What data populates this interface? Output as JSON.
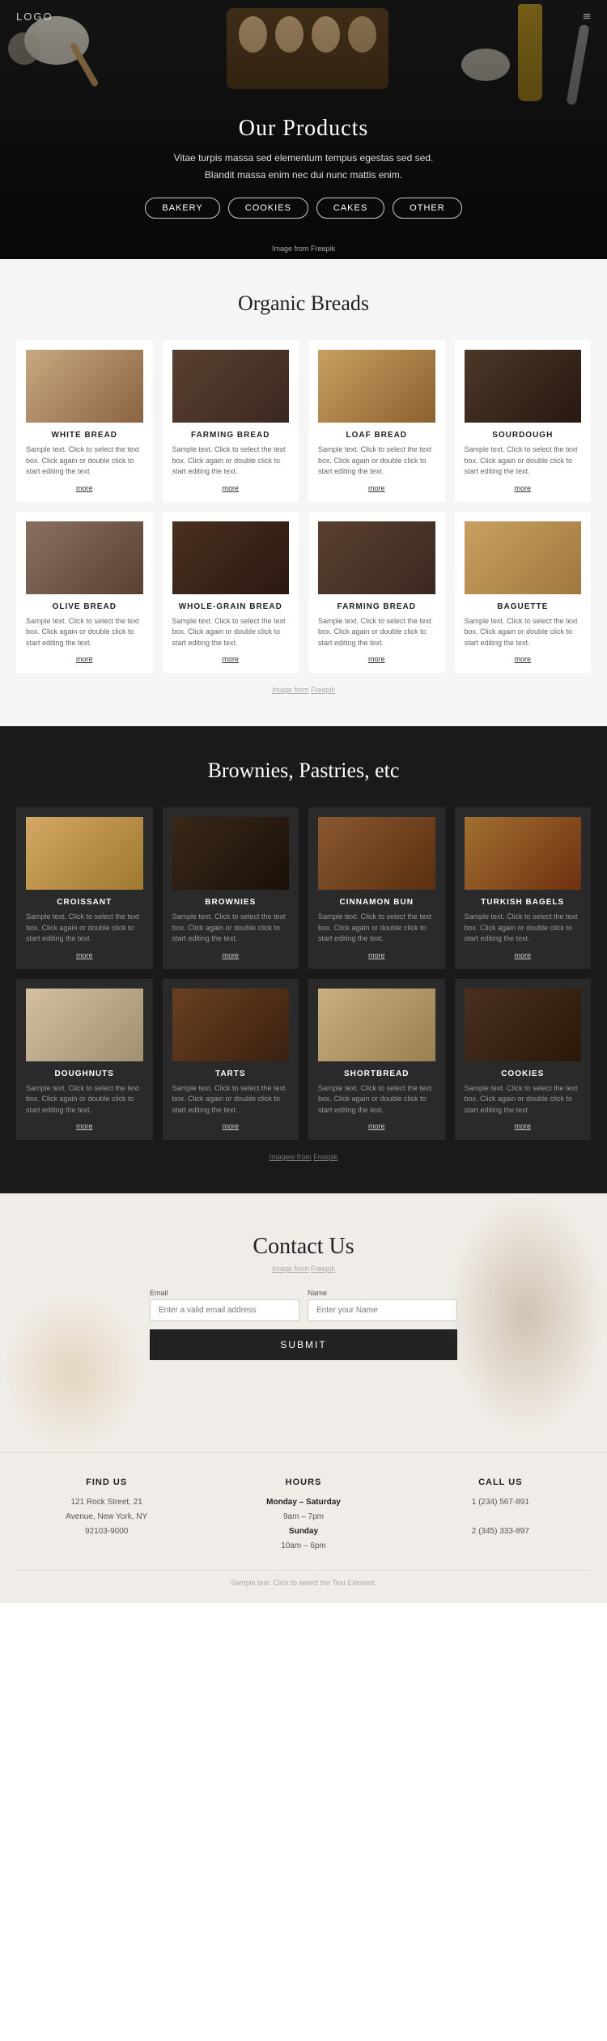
{
  "nav": {
    "logo": "logo",
    "menu_icon": "≡"
  },
  "hero": {
    "title": "Our Products",
    "subtitle_line1": "Vitae turpis massa sed elementum tempus egestas sed sed.",
    "subtitle_line2": "Blandit massa enim nec dui nunc mattis enim.",
    "buttons": [
      "BAKERY",
      "COOKIES",
      "CAKES",
      "OTHER"
    ],
    "credit": "Image from Freepik"
  },
  "breads": {
    "section_title": "Organic Breads",
    "credit": "Image from",
    "credit_link": "Freepik",
    "items": [
      {
        "name": "WHITE BREAD",
        "desc": "Sample text. Click to select the text box. Click again or double click to start editing the text.",
        "more": "more",
        "img_class": "img-white-bread"
      },
      {
        "name": "FARMING BREAD",
        "desc": "Sample text. Click to select the text box. Click again or double click to start editing the text.",
        "more": "more",
        "img_class": "img-farming-bread"
      },
      {
        "name": "LOAF BREAD",
        "desc": "Sample text. Click to select the text box. Click again or double click to start editing the text.",
        "more": "more",
        "img_class": "img-loaf-bread"
      },
      {
        "name": "SOURDOUGH",
        "desc": "Sample text. Click to select the text box. Click again or double click to start editing the text.",
        "more": "more",
        "img_class": "img-sourdough"
      },
      {
        "name": "OLIVE BREAD",
        "desc": "Sample text. Click to select the text box. Click again or double click to start editing the text.",
        "more": "more",
        "img_class": "img-olive-bread"
      },
      {
        "name": "WHOLE-GRAIN BREAD",
        "desc": "Sample text. Click to select the text box. Click again or double click to start editing the text.",
        "more": "more",
        "img_class": "img-wholegrain"
      },
      {
        "name": "FARMING BREAD",
        "desc": "Sample text. Click to select the text box. Click again or double click to start editing the text.",
        "more": "more",
        "img_class": "img-farming2"
      },
      {
        "name": "BAGUETTE",
        "desc": "Sample text. Click to select the text box. Click again or double click to start editing the text.",
        "more": "more",
        "img_class": "img-baguette"
      }
    ]
  },
  "pastries": {
    "section_title": "Brownies, Pastries, etc",
    "credit": "Imagew from",
    "credit_link": "Freepik",
    "items": [
      {
        "name": "CROISSANT",
        "desc": "Sample text. Click to select the text box. Click again or double click to start editing the text.",
        "more": "more",
        "img_class": "img-croissant"
      },
      {
        "name": "BROWNIES",
        "desc": "Sample text. Click to select the text box. Click again or double click to start editing the text.",
        "more": "more",
        "img_class": "img-brownies"
      },
      {
        "name": "CINNAMON BUN",
        "desc": "Sample text. Click to select the text box. Click again or double click to start editing the text.",
        "more": "more",
        "img_class": "img-cinnamon"
      },
      {
        "name": "TURKISH BAGELS",
        "desc": "Sample text. Click to select the text box. Click again or double click to start editing the text.",
        "more": "more",
        "img_class": "img-turkish"
      },
      {
        "name": "DOUGHNUTS",
        "desc": "Sample text. Click to select the text box. Click again or double click to start editing the text.",
        "more": "more",
        "img_class": "img-doughnuts"
      },
      {
        "name": "TARTS",
        "desc": "Sample text. Click to select the text box. Click again or double click to start editing the text.",
        "more": "more",
        "img_class": "img-tarts"
      },
      {
        "name": "SHORTBREAD",
        "desc": "Sample text. Click to select the text box. Click again or double click to start editing the text.",
        "more": "more",
        "img_class": "img-shortbread"
      },
      {
        "name": "COOKIES",
        "desc": "Sample text. Click to select the text box. Click again or double click to start editing the text.",
        "more": "more",
        "img_class": "img-cookies"
      }
    ]
  },
  "contact": {
    "title": "Contact Us",
    "credit": "Image from",
    "credit_link": "Freepik",
    "email_label": "Email",
    "email_placeholder": "Enter a valid email address",
    "name_label": "Name",
    "name_placeholder": "Enter your Name",
    "submit_label": "SUBMIT"
  },
  "footer": {
    "find_us": {
      "heading": "FIND US",
      "line1": "121 Rock Street, 21",
      "line2": "Avenue, New York, NY",
      "line3": "92103-9000"
    },
    "hours": {
      "heading": "HOURS",
      "days1": "Monday – Saturday",
      "time1": "9am – 7pm",
      "days2": "Sunday",
      "time2": "10am – 6pm"
    },
    "call_us": {
      "heading": "CALL US",
      "phone1": "1 (234) 567-891",
      "phone2": "2 (345) 333-897"
    },
    "bottom_text": "Sample text. Click to select the Text Element."
  }
}
